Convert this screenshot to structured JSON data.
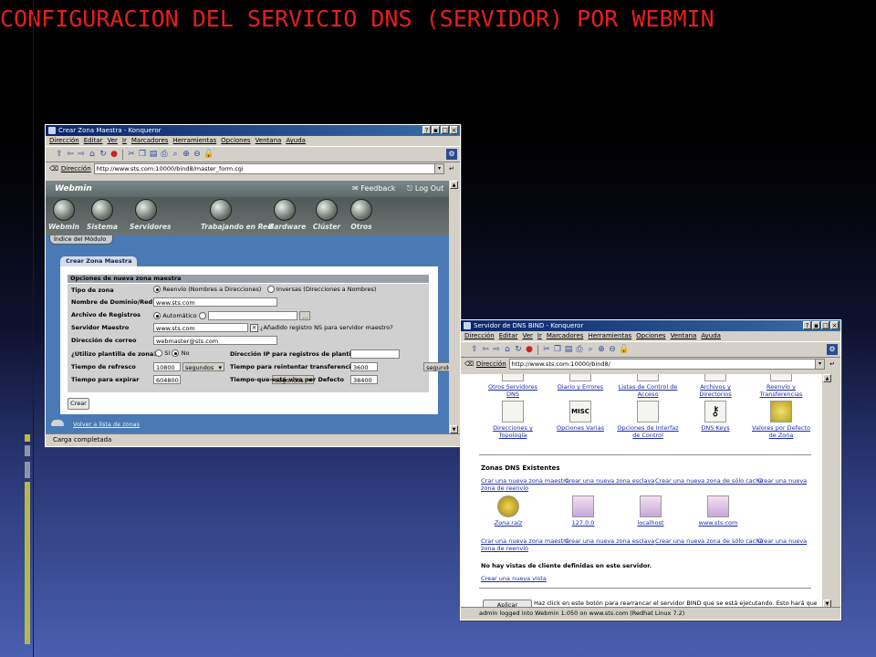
{
  "slide": {
    "title": "CONFIGURACION DEL SERVICIO DNS (SERVIDOR) POR WEBMIN",
    "colors": {
      "title": "#e41e1e",
      "accent_bar": "#b8b84a",
      "titlebar": "#0a246a"
    }
  },
  "win1": {
    "title": "Crear Zona Maestra - Konqueror",
    "menu": [
      "Dirección",
      "Editar",
      "Ver",
      "Ir",
      "Marcadores",
      "Herramientas",
      "Opciones",
      "Ventana",
      "Ayuda"
    ],
    "address_label": "Dirección",
    "url": "http://www.sts.com:10000/bind8/master_form.cgi",
    "status": "Carga completada",
    "webmin": {
      "logo": "Webmin",
      "feedback": "Feedback",
      "logout": "Log Out",
      "modules": [
        "Webmin",
        "Sistema",
        "Servidores",
        "Trabajando en Red",
        "Hardware",
        "Clúster",
        "Otros"
      ],
      "module_index": "Índice del Módulo",
      "tab": "Crear Zona Maestra",
      "section_title": "Opciones de nueva zona maestra",
      "form": {
        "zone_type_label": "Tipo de zona",
        "zone_type_forward": "Reenvío (Nombres a Direcciones)",
        "zone_type_reverse": "Inversas (Direcciones a Nombres)",
        "domain_label": "Nombre de Dominio/Red",
        "domain_value": "www.sts.com",
        "records_file_label": "Archivo de Registros",
        "records_file_auto": "Automático",
        "records_file_btn": "...",
        "master_server_label": "Servidor Maestro",
        "master_server_value": "www.sts.com",
        "ns_question": "¿Añadido registro NS para servidor maestro?",
        "email_label": "Dirección de correo",
        "email_value": "webmaster@sts.com",
        "template_label": "¿Utilizo plantilla de zona?",
        "template_yes": "Sí",
        "template_no": "No",
        "template_ip_label": "Dirección IP para registros de plantilla",
        "refresh_label": "Tiempo de refresco",
        "refresh_value": "10800",
        "retry_label": "Tiempo para reintentar transferencia",
        "retry_value": "3600",
        "expire_label": "Tiempo para expirar",
        "expire_value": "604800",
        "ttl_label": "Tiempo-que-está-viva por Defecto",
        "ttl_value": "38400",
        "unit": "segundos",
        "create_button": "Crear"
      },
      "back_link": "Volver a lista de zonas"
    }
  },
  "win2": {
    "title": "Servidor de DNS BIND - Konqueror",
    "menu": [
      "Dirección",
      "Editar",
      "Ver",
      "Ir",
      "Marcadores",
      "Herramientas",
      "Opciones",
      "Ventana",
      "Ayuda"
    ],
    "address_label": "Dirección",
    "url": "http://www.sts.com:10000/bind8/",
    "status": "admin logged into Webmin 1.050 on www.sts.com (Redhat Linux 7.2)",
    "top_icons": [
      {
        "label": "Otros Servidores DNS"
      },
      {
        "label": "Diario y Errores"
      },
      {
        "label": "Listas de Control de Acceso"
      },
      {
        "label": "Archivos y Directorios"
      },
      {
        "label": "Reenvío y Transferencias"
      }
    ],
    "mid_icons": [
      {
        "label": "Direcciones y Topología"
      },
      {
        "label": "Opciones Varias",
        "glyph": "MISC"
      },
      {
        "label": "Opciones de Interfaz de Control"
      },
      {
        "label": "DNS Keys"
      },
      {
        "label": "Valores por Defecto de Zona"
      }
    ],
    "zones_heading": "Zonas DNS Existentes",
    "zone_links_1": "Crar una nueva zona maestra",
    "zone_links_2": "Crear una nueva zona esclava",
    "zone_links_3": "Crear una nueva zona de sólo caché",
    "zone_links_4": "Crear una nueva zona de reenvío",
    "zones": [
      {
        "label": "Zona raíz"
      },
      {
        "label": "127.0.0"
      },
      {
        "label": "localhost"
      },
      {
        "label": "www.sts.com"
      }
    ],
    "zone_links_b1": "Crar una nueva zona maestra",
    "no_views": "No hay vistas de cliente definidas en este servidor.",
    "new_view": "Crear una nueva vista",
    "apply_button": "Aplicar Cambios",
    "apply_text": "Haz click en este botón para rearrancar el servidor BIND que se está ejecutando. Esto hará que la"
  }
}
